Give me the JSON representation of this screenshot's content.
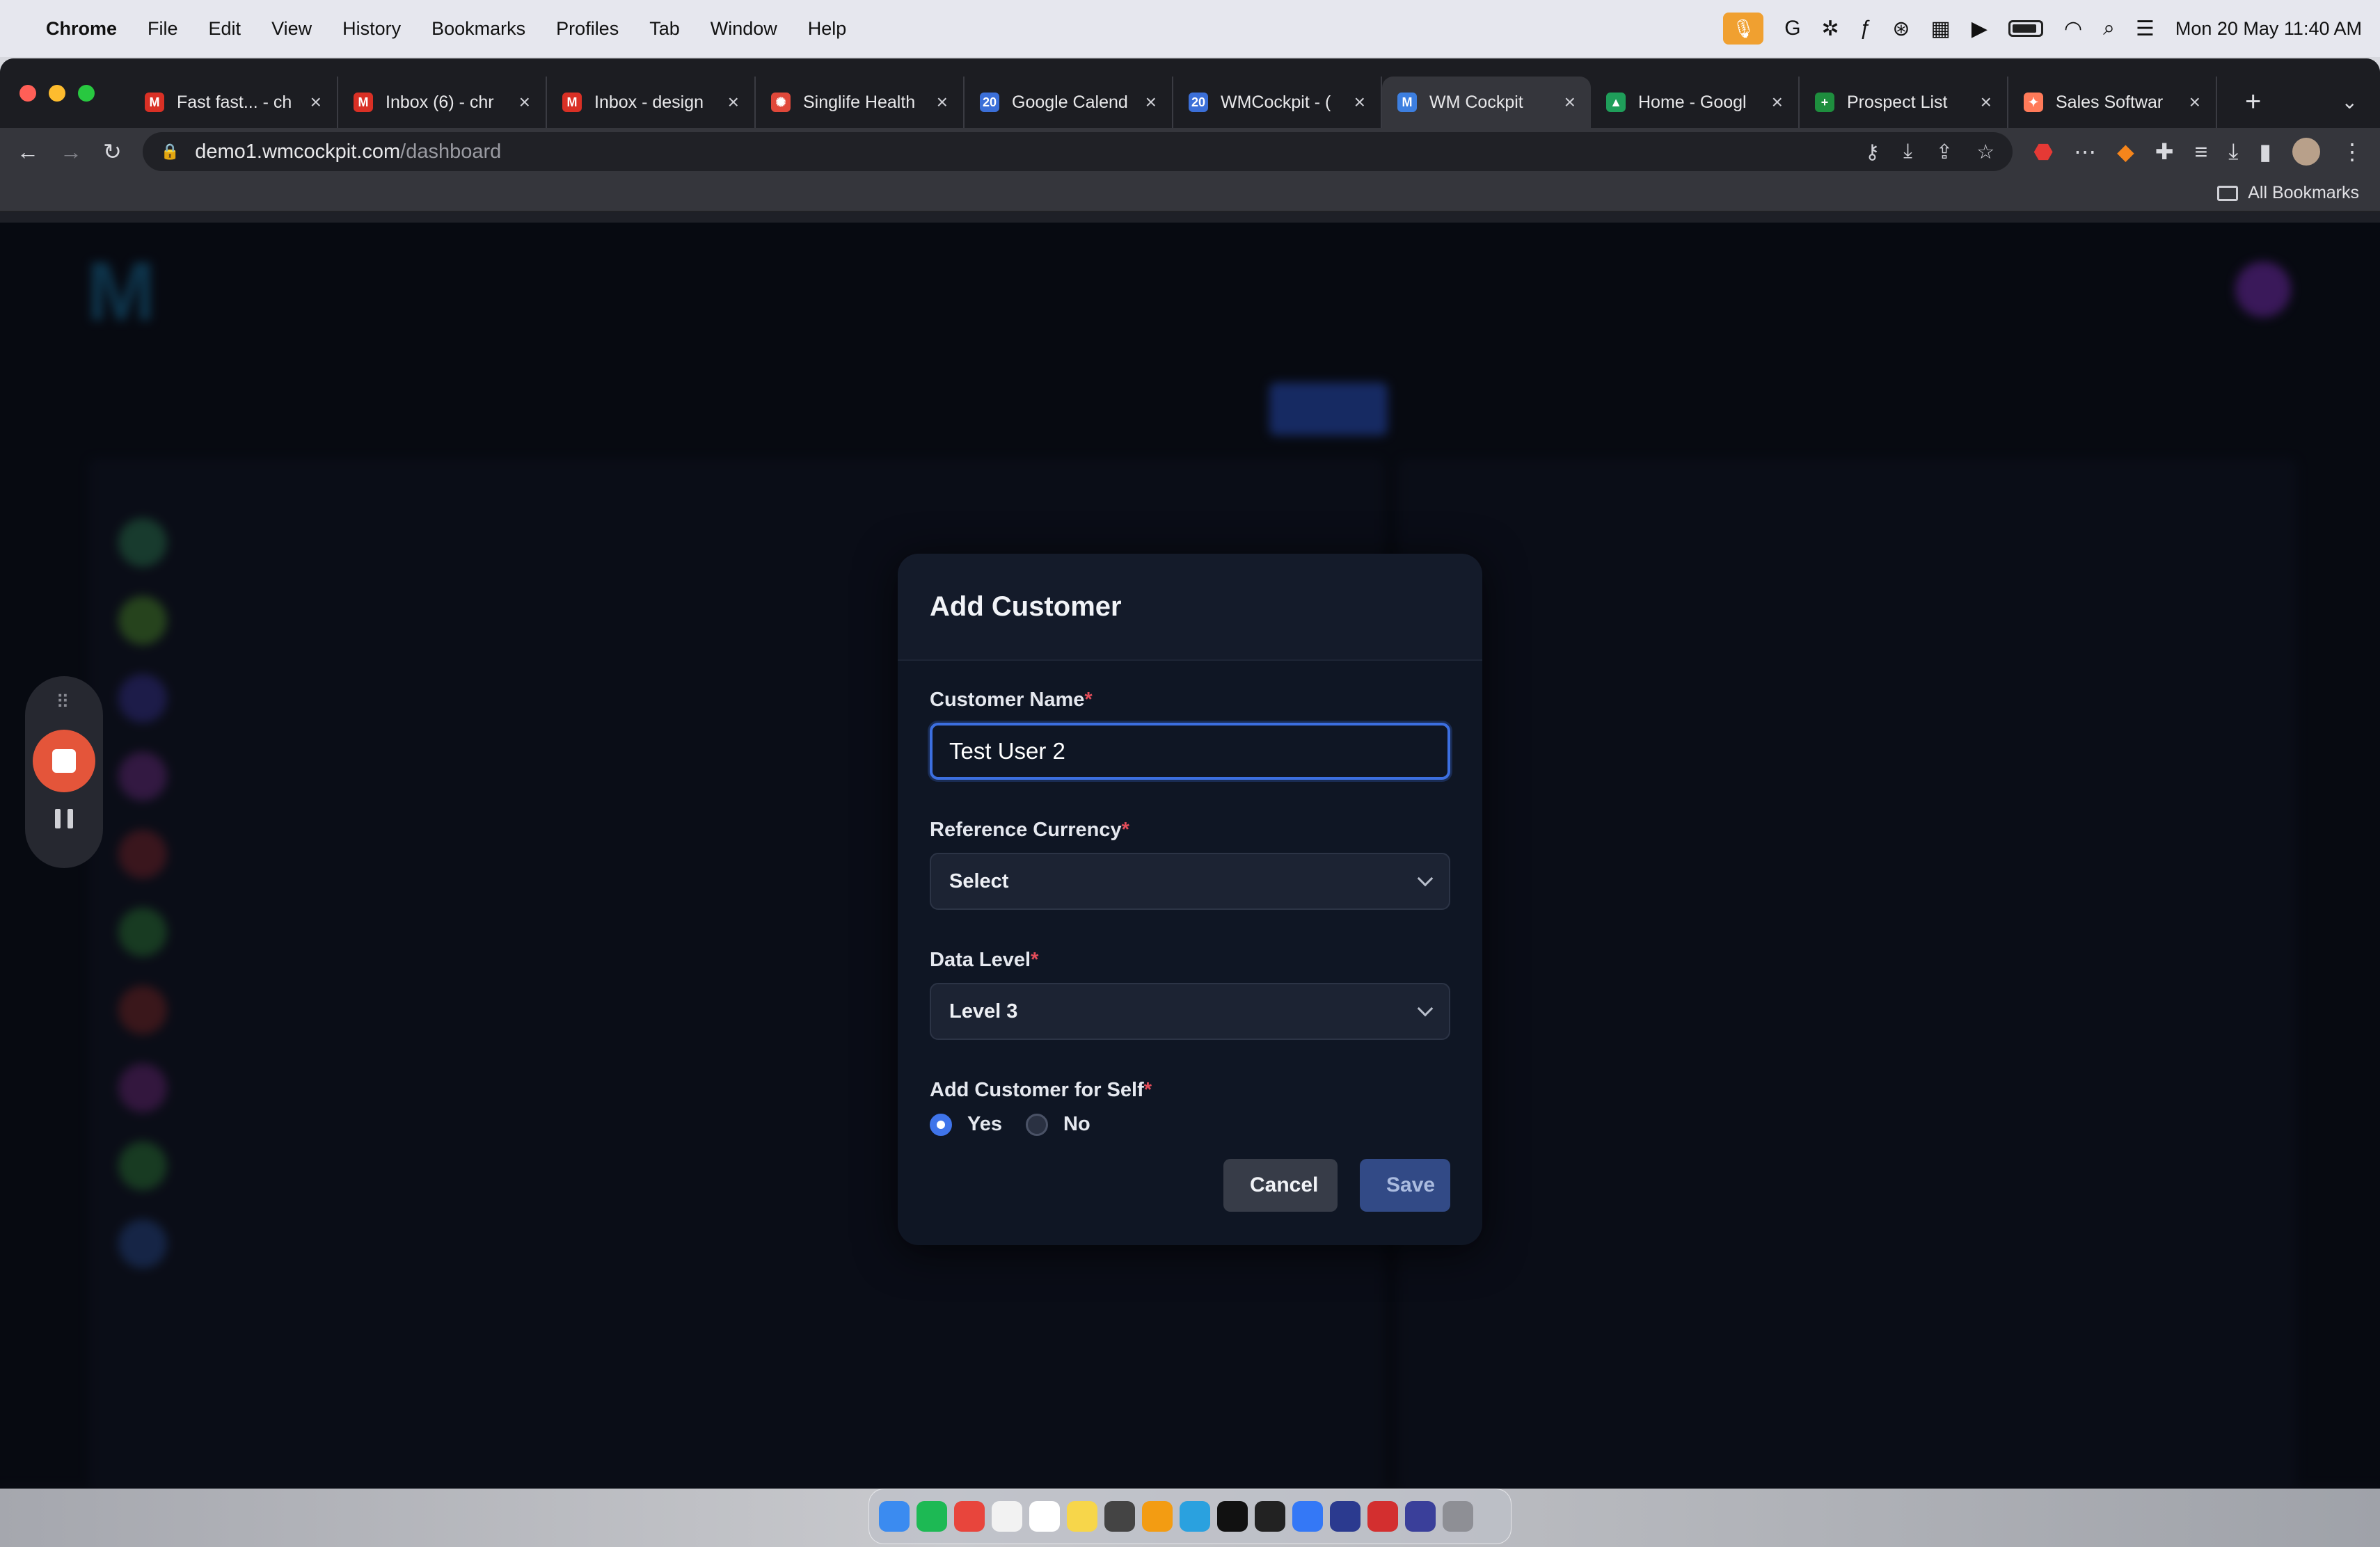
{
  "menubar": {
    "app": "Chrome",
    "items": [
      "File",
      "Edit",
      "View",
      "History",
      "Bookmarks",
      "Profiles",
      "Tab",
      "Window",
      "Help"
    ],
    "datetime": "Mon 20 May  11:40 AM"
  },
  "browser": {
    "tabs": [
      {
        "title": "Fast fast... - ch",
        "fav": "M",
        "color": "#d93025"
      },
      {
        "title": "Inbox (6) - chr",
        "fav": "M",
        "color": "#d93025"
      },
      {
        "title": "Inbox - design",
        "fav": "M",
        "color": "#d93025"
      },
      {
        "title": "Singlife Health",
        "fav": "✺",
        "color": "#e0483a"
      },
      {
        "title": "Google Calend",
        "fav": "20",
        "color": "#3b6fd8"
      },
      {
        "title": "WMCockpit - (",
        "fav": "20",
        "color": "#3b6fd8"
      },
      {
        "title": "WM Cockpit",
        "fav": "M",
        "color": "#3d7fe0"
      },
      {
        "title": "Home - Googl",
        "fav": "▲",
        "color": "#1f9e5a"
      },
      {
        "title": "Prospect List",
        "fav": "+",
        "color": "#1e8e3e"
      },
      {
        "title": "Sales Softwar",
        "fav": "✦",
        "color": "#ff7a59"
      }
    ],
    "url_host": "demo1.wmcockpit.com",
    "url_path": "/dashboard",
    "bookmarks_label": "All Bookmarks"
  },
  "modal": {
    "title": "Add Customer",
    "customer_name": {
      "label": "Customer Name",
      "value": "Test User 2"
    },
    "reference_currency": {
      "label": "Reference Currency",
      "value": "Select"
    },
    "data_level": {
      "label": "Data Level",
      "value": "Level 3"
    },
    "add_for_self": {
      "label": "Add Customer for Self",
      "options": [
        {
          "label": "Yes",
          "checked": true
        },
        {
          "label": "No",
          "checked": false
        }
      ]
    },
    "required_mark": "*",
    "cancel_label": "Cancel",
    "save_label": "Save"
  },
  "colors": {
    "accent": "#3c6fe0",
    "required": "#e24d5a",
    "modal_bg": "#0f1624",
    "record": "#e4553a"
  }
}
